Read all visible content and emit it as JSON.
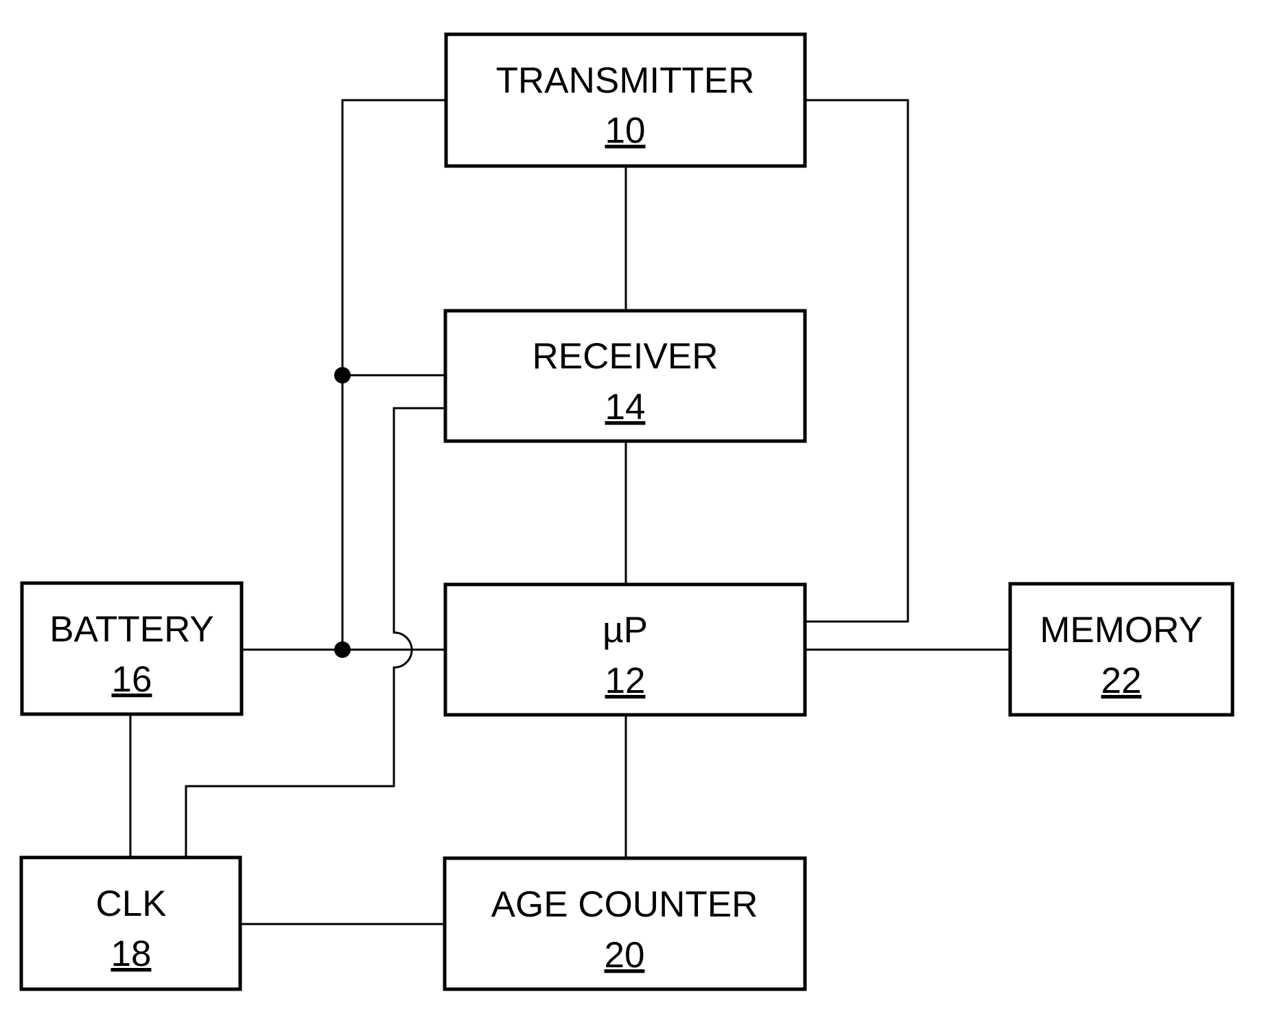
{
  "diagram": {
    "type": "block-diagram",
    "colors": {
      "line": "#000000",
      "background": "#ffffff"
    },
    "blocks": {
      "transmitter": {
        "label": "TRANSMITTER",
        "ref": "10"
      },
      "receiver": {
        "label": "RECEIVER",
        "ref": "14"
      },
      "microprocessor": {
        "label": "µP",
        "ref": "12"
      },
      "battery": {
        "label": "BATTERY",
        "ref": "16"
      },
      "memory": {
        "label": "MEMORY",
        "ref": "22"
      },
      "clock": {
        "label": "CLK",
        "ref": "18"
      },
      "age_counter": {
        "label": "AGE COUNTER",
        "ref": "20"
      }
    },
    "connections": [
      {
        "from": "transmitter",
        "to": "receiver"
      },
      {
        "from": "receiver",
        "to": "microprocessor"
      },
      {
        "from": "microprocessor",
        "to": "age_counter"
      },
      {
        "from": "microprocessor",
        "to": "memory"
      },
      {
        "from": "microprocessor",
        "to": "transmitter"
      },
      {
        "from": "battery",
        "to": "microprocessor"
      },
      {
        "from": "battery",
        "to": "transmitter",
        "junction": true
      },
      {
        "from": "battery",
        "to": "receiver",
        "junction": true
      },
      {
        "from": "battery",
        "to": "clock"
      },
      {
        "from": "clock",
        "to": "receiver",
        "crossover": true
      },
      {
        "from": "clock",
        "to": "age_counter"
      }
    ]
  }
}
